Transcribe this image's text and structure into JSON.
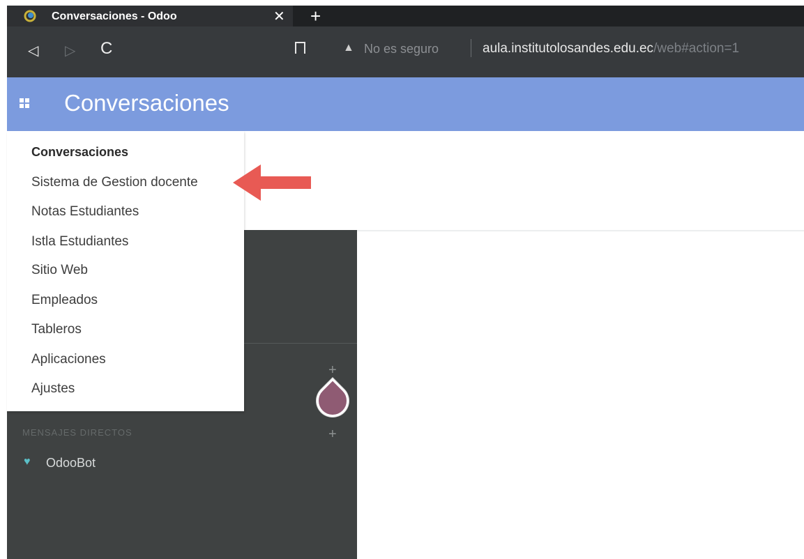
{
  "browser": {
    "tab_title": "Conversaciones - Odoo",
    "tab_close": "✕",
    "new_tab": "+",
    "nav_back": "◁",
    "nav_forward": "▷",
    "nav_reload": "C",
    "warning_icon": "▲",
    "security_label": "No es seguro",
    "url_host": "aula.institutolosandes.edu.ec",
    "url_path": "/web#action=1"
  },
  "navbar": {
    "title": "Conversaciones"
  },
  "apps_menu": {
    "items": [
      "Conversaciones",
      "Sistema de Gestion docente",
      "Notas Estudiantes",
      "Istla Estudiantes",
      "Sitio Web",
      "Empleados",
      "Tableros",
      "Aplicaciones",
      "Ajustes"
    ]
  },
  "sidebar": {
    "add_channel": "+",
    "add_dm": "+",
    "direct_messages_header": "MENSAJES DIRECTOS",
    "dm_items": [
      {
        "label": "OdooBot",
        "icon": "heart-icon"
      }
    ]
  },
  "colors": {
    "navbar": "#7c9bde",
    "sidebar": "#3f4242",
    "arrow": "#e85a54",
    "drop_marker": "#8f5b73"
  }
}
